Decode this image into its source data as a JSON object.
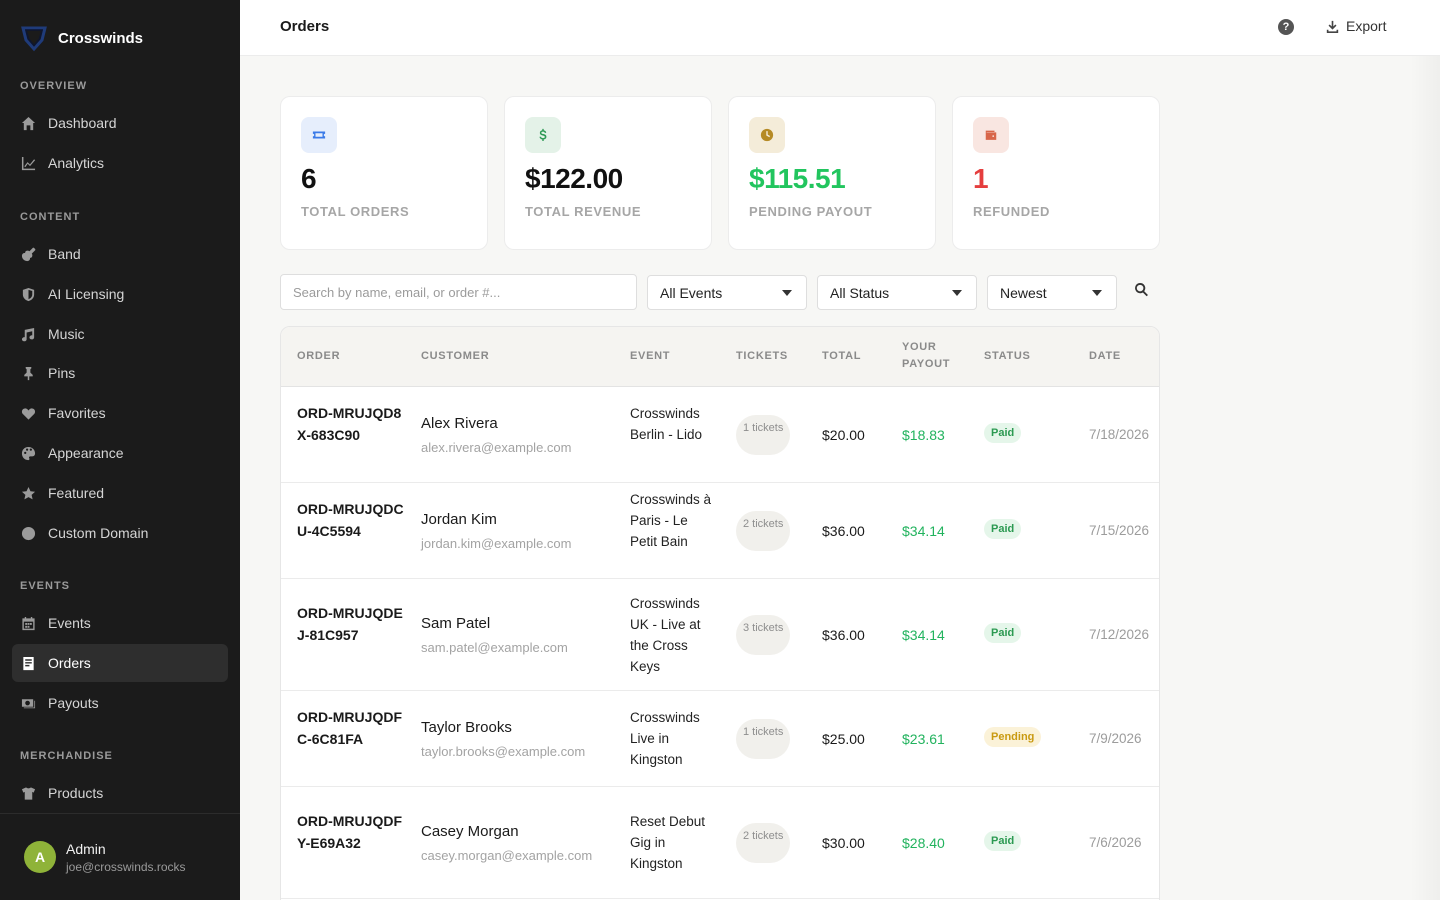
{
  "brand": {
    "name": "Crosswinds"
  },
  "sidebar": {
    "sections": [
      {
        "title": "OVERVIEW",
        "items": [
          {
            "label": "Dashboard",
            "icon": "home-icon"
          },
          {
            "label": "Analytics",
            "icon": "chart-line-icon"
          }
        ]
      },
      {
        "title": "CONTENT",
        "items": [
          {
            "label": "Band",
            "icon": "guitar-icon"
          },
          {
            "label": "AI Licensing",
            "icon": "shield-icon"
          },
          {
            "label": "Music",
            "icon": "music-note-icon"
          },
          {
            "label": "Pins",
            "icon": "pin-icon"
          },
          {
            "label": "Favorites",
            "icon": "heart-icon"
          },
          {
            "label": "Appearance",
            "icon": "palette-icon"
          },
          {
            "label": "Featured",
            "icon": "star-icon"
          },
          {
            "label": "Custom Domain",
            "icon": "globe-icon"
          }
        ]
      },
      {
        "title": "EVENTS",
        "items": [
          {
            "label": "Events",
            "icon": "calendar-icon"
          },
          {
            "label": "Orders",
            "icon": "receipt-icon",
            "active": true
          },
          {
            "label": "Payouts",
            "icon": "money-icon"
          }
        ]
      },
      {
        "title": "MERCHANDISE",
        "items": [
          {
            "label": "Products",
            "icon": "shirt-icon"
          }
        ]
      }
    ],
    "user": {
      "initial": "A",
      "name": "Admin",
      "email": "joe@crosswinds.rocks",
      "avatar_color": "#8fb339"
    }
  },
  "header": {
    "title": "Orders",
    "help": "?",
    "export_label": "Export"
  },
  "stats": [
    {
      "value": "6",
      "label": "TOTAL ORDERS",
      "icon": "ticket-icon",
      "value_color": "#111111",
      "icon_bg": "#e6eefc",
      "icon_color": "#3b7be8"
    },
    {
      "value": "$122.00",
      "label": "TOTAL REVENUE",
      "icon": "dollar-icon",
      "value_color": "#111111",
      "icon_bg": "#e4f2e8",
      "icon_color": "#2e9a55"
    },
    {
      "value": "$115.51",
      "label": "PENDING PAYOUT",
      "icon": "clock-icon",
      "value_color": "#22c55e",
      "icon_bg": "#f4ecd9",
      "icon_color": "#b58a25"
    },
    {
      "value": "1",
      "label": "REFUNDED",
      "icon": "wallet-icon",
      "value_color": "#e53e3e",
      "icon_bg": "#f9e6e1",
      "icon_color": "#d8664a"
    }
  ],
  "filters": {
    "search_placeholder": "Search by name, email, or order #...",
    "event_select": "All Events",
    "status_select": "All Status",
    "sort_select": "Newest"
  },
  "table": {
    "headers": [
      "ORDER",
      "CUSTOMER",
      "EVENT",
      "TICKETS",
      "TOTAL",
      "YOUR PAYOUT",
      "STATUS",
      "DATE"
    ],
    "rows": [
      {
        "order": "ORD-MRUJQD8X-683C90",
        "customer": "Alex Rivera",
        "email": "alex.rivera@example.com",
        "event": "Crosswinds Berlin - Lido",
        "tickets": "1 tickets",
        "total": "$20.00",
        "payout": "$18.83",
        "status": "Paid",
        "date": "7/18/2026"
      },
      {
        "order": "ORD-MRUJQDCU-4C5594",
        "customer": "Jordan Kim",
        "email": "jordan.kim@example.com",
        "event": "Crosswinds à Paris - Le Petit Bain",
        "tickets": "2 tickets",
        "total": "$36.00",
        "payout": "$34.14",
        "status": "Paid",
        "date": "7/15/2026"
      },
      {
        "order": "ORD-MRUJQDEJ-81C957",
        "customer": "Sam Patel",
        "email": "sam.patel@example.com",
        "event": "Crosswinds UK - Live at the Cross Keys",
        "tickets": "3 tickets",
        "total": "$36.00",
        "payout": "$34.14",
        "status": "Paid",
        "date": "7/12/2026"
      },
      {
        "order": "ORD-MRUJQDFC-6C81FA",
        "customer": "Taylor Brooks",
        "email": "taylor.brooks@example.com",
        "event": "Crosswinds Live in Kingston",
        "tickets": "1 tickets",
        "total": "$25.00",
        "payout": "$23.61",
        "status": "Pending",
        "date": "7/9/2026"
      },
      {
        "order": "ORD-MRUJQDFY-E69A32",
        "customer": "Casey Morgan",
        "email": "casey.morgan@example.com",
        "event": "Reset Debut Gig in Kingston",
        "tickets": "2 tickets",
        "total": "$30.00",
        "payout": "$28.40",
        "status": "Paid",
        "date": "7/6/2026"
      }
    ]
  }
}
